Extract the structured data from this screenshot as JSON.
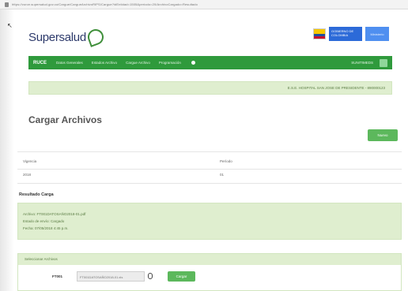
{
  "browser": {
    "url": "https://vurce.supersalud.gov.co/Cargue/CargueArchivoRIPS/Cargue?idEntidad=1505&periodo=20/ArchivoCargado=Resultado"
  },
  "header": {
    "logo_text": "Supersalud"
  },
  "gov": {
    "badge1": "GOBIERNO DE COLOMBIA",
    "badge2": "Ministerio"
  },
  "nav": {
    "brand": "RUCE",
    "items": [
      "Datos Generales",
      "Estados Archivo",
      "Cargue Archivo",
      "Programación"
    ],
    "user": "SUNITIMEDS"
  },
  "entity_bar": {
    "text": "E.S.E. HOSPITAL SAN JOSE DE PRESIDENTE - 890000123"
  },
  "page": {
    "title": "Cargar Archivos",
    "new_button": "Nuevo"
  },
  "table": {
    "headers": [
      "Vigencia",
      "Período"
    ],
    "rows": [
      [
        "2018",
        "01"
      ]
    ]
  },
  "result": {
    "title": "Resultado Carga",
    "lines": [
      "Archivo: FT001DATOSAÑO2018-01.pdf",
      "Estado de envío: Cargado",
      "Fecha: 07/05/2018 4:45 p.m."
    ]
  },
  "upload": {
    "header": "Seleccionar Archivos",
    "label": "FT001",
    "file_value": "FT001DATOSAÑO2018-01.xls",
    "button": "Cargar"
  }
}
